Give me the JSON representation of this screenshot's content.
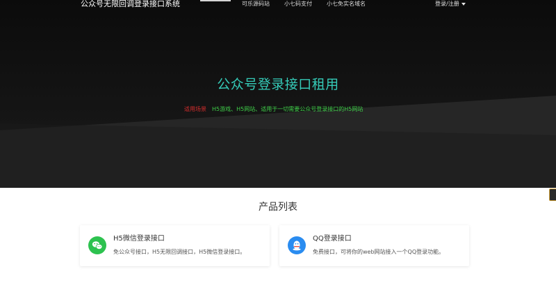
{
  "header": {
    "brand": "公众号无限回调登录接口系统",
    "nav": [
      "可乐源码站",
      "小七码支付",
      "小七免实名域名"
    ],
    "login": "登录/注册"
  },
  "hero": {
    "title": "公众号登录接口租用",
    "subtitle_label": "适用场景",
    "subtitle_text": "H5游戏、H5网站、适用于一切需要公众号登录接口的H5网站"
  },
  "products": {
    "title": "产品列表",
    "items": [
      {
        "title": "H5微信登录接口",
        "desc": "免公众号接口，H5无限回调接口，H5微信登录接口。",
        "icon": "wechat-icon"
      },
      {
        "title": "QQ登录接口",
        "desc": "免费接口，可将你的web网站接入一个QQ登录功能。",
        "icon": "qq-icon"
      }
    ]
  },
  "colors": {
    "accent_title": "#35cbb8",
    "subtitle_label": "#d42d2d",
    "subtitle_text": "#3fcf49",
    "wechat": "#2dc24f",
    "qq": "#2a8cf0"
  }
}
